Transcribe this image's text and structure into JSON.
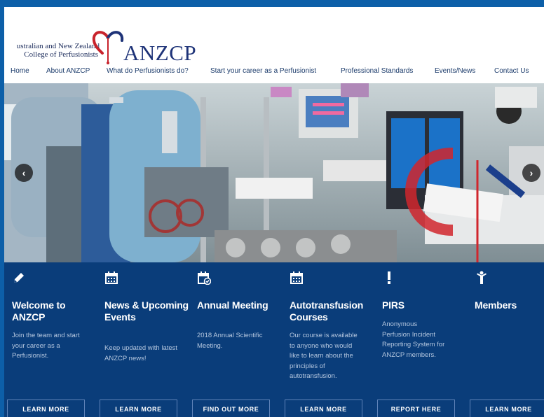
{
  "logo": {
    "line1": "ustralian and New Zealand",
    "line2": "College of Perfusionists",
    "abbr": "ANZCP"
  },
  "nav": [
    "Home",
    "About ANZCP",
    "What do Perfusionists do?",
    "Start your career as a Perfusionist",
    "Professional Standards",
    "Events/News",
    "Contact Us"
  ],
  "hero": {
    "prev_icon": "chevron-left-icon",
    "next_icon": "chevron-right-icon",
    "prev_glyph": "‹",
    "next_glyph": "›"
  },
  "cards": [
    {
      "icon": "pencil-icon",
      "title": "Welcome to ANZCP",
      "desc": "Join the team and start your career as a Perfusionist.",
      "button": "LEARN MORE"
    },
    {
      "icon": "calendar-icon",
      "title": "News & Upcoming Events",
      "desc": "Keep updated with latest ANZCP news!",
      "button": "LEARN MORE"
    },
    {
      "icon": "calendar-check-icon",
      "title": "Annual Meeting",
      "desc": "2018 Annual Scientific Meeting.",
      "button": "FIND OUT MORE"
    },
    {
      "icon": "calendar-icon",
      "title": "Autotransfusion Courses",
      "desc": "Our course is available to anyone who would like to learn about the principles of autotransfusion.",
      "button": "LEARN MORE"
    },
    {
      "icon": "exclamation-icon",
      "title": "PIRS",
      "desc": "Anonymous Perfusion Incident Reporting System for ANZCP members.",
      "button": "REPORT HERE"
    },
    {
      "icon": "person-icon",
      "title": "Members",
      "desc": "",
      "button": "LEARN MORE"
    }
  ],
  "colors": {
    "border": "#0d5fa8",
    "panel": "#0a3d7a",
    "logo_red": "#c8232c",
    "logo_blue": "#1e3378"
  }
}
